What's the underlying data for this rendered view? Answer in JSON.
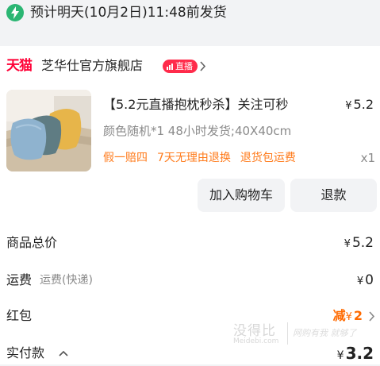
{
  "delivery": {
    "text": "预计明天(10月2日)11:48前发货"
  },
  "shop": {
    "platform_logo": "天猫",
    "name": "芝华仕官方旗舰店",
    "live_badge": "直播"
  },
  "product": {
    "title": "【5.2元直播抱枕秒杀】关注可秒",
    "price": "5.2",
    "spec": "颜色随机*1 48小时发货;40X40cm",
    "services": [
      "假一赔四",
      "7天无理由退换",
      "退货包运费"
    ],
    "qty": "x1"
  },
  "actions": {
    "add_cart": "加入购物车",
    "refund": "退款"
  },
  "summary": {
    "total_label": "商品总价",
    "total_value": "5.2",
    "shipping_label": "运费",
    "shipping_sub": "运费(快递)",
    "shipping_value": "0",
    "redpacket_label": "红包",
    "redpacket_prefix": "减",
    "redpacket_value": "2",
    "paid_label": "实付款",
    "paid_value": "3.2"
  },
  "currency": "¥",
  "watermark": {
    "cn": "没得比",
    "en": "Meidebi.com",
    "slogan": "网购有我 就够了"
  },
  "colors": {
    "accent_orange": "#ff6a00",
    "tmall_red": "#ff0036",
    "delivery_green": "#2bb673",
    "service_orange": "#ff7a1a"
  },
  "icons": [
    "lightning-icon",
    "live-bars-icon",
    "chevron-right-icon",
    "chevron-up-icon"
  ]
}
